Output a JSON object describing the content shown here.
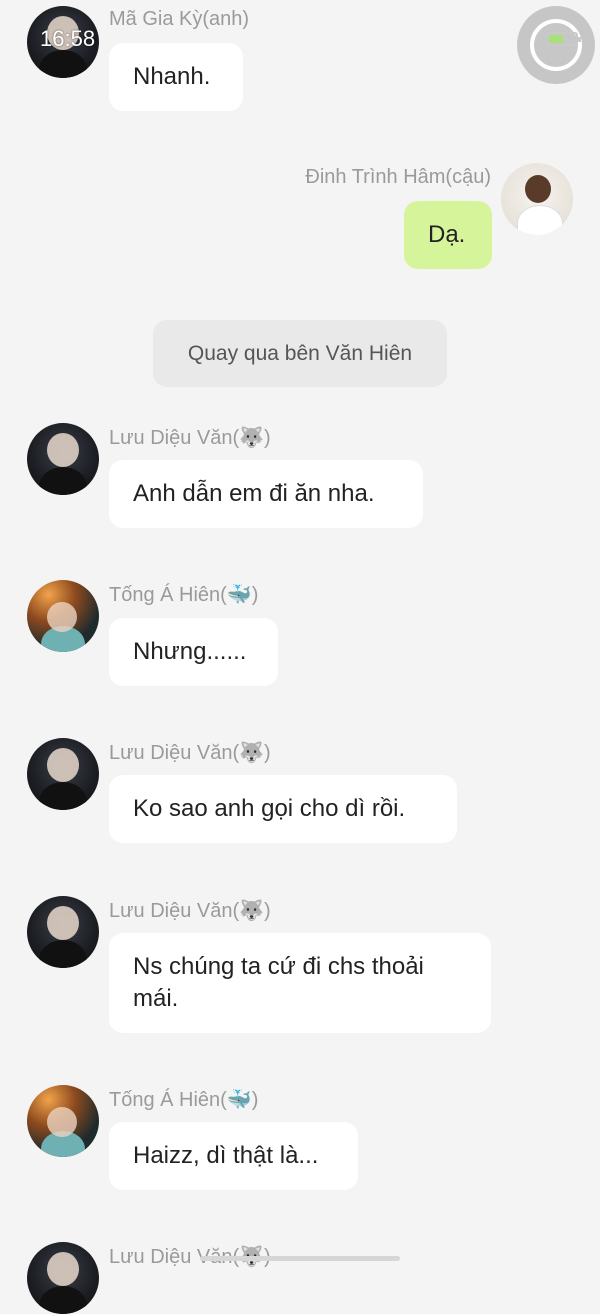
{
  "status_bar": {
    "time": "16:58"
  },
  "messages": [
    {
      "sender": "Mã Gia Kỳ(anh)",
      "text": "Nhanh."
    },
    {
      "sender": "Đinh Trình Hâm(cậu)",
      "text": "Dạ."
    },
    {
      "system": "Quay qua bên Văn Hiên"
    },
    {
      "sender": "Lưu Diệu Văn(🐺)",
      "text": "Anh dẫn em đi ăn nha."
    },
    {
      "sender": "Tống Á Hiên(🐳)",
      "text": "Nhưng......"
    },
    {
      "sender": "Lưu Diệu Văn(🐺)",
      "text": "Ko sao anh gọi cho dì rồi."
    },
    {
      "sender": "Lưu Diệu Văn(🐺)",
      "text": "Ns chúng ta cứ đi chs thoải mái."
    },
    {
      "sender": "Tống Á Hiên(🐳)",
      "text": "Haizz, dì thật là..."
    },
    {
      "sender": "Lưu Diệu Văn(🐺)"
    }
  ]
}
